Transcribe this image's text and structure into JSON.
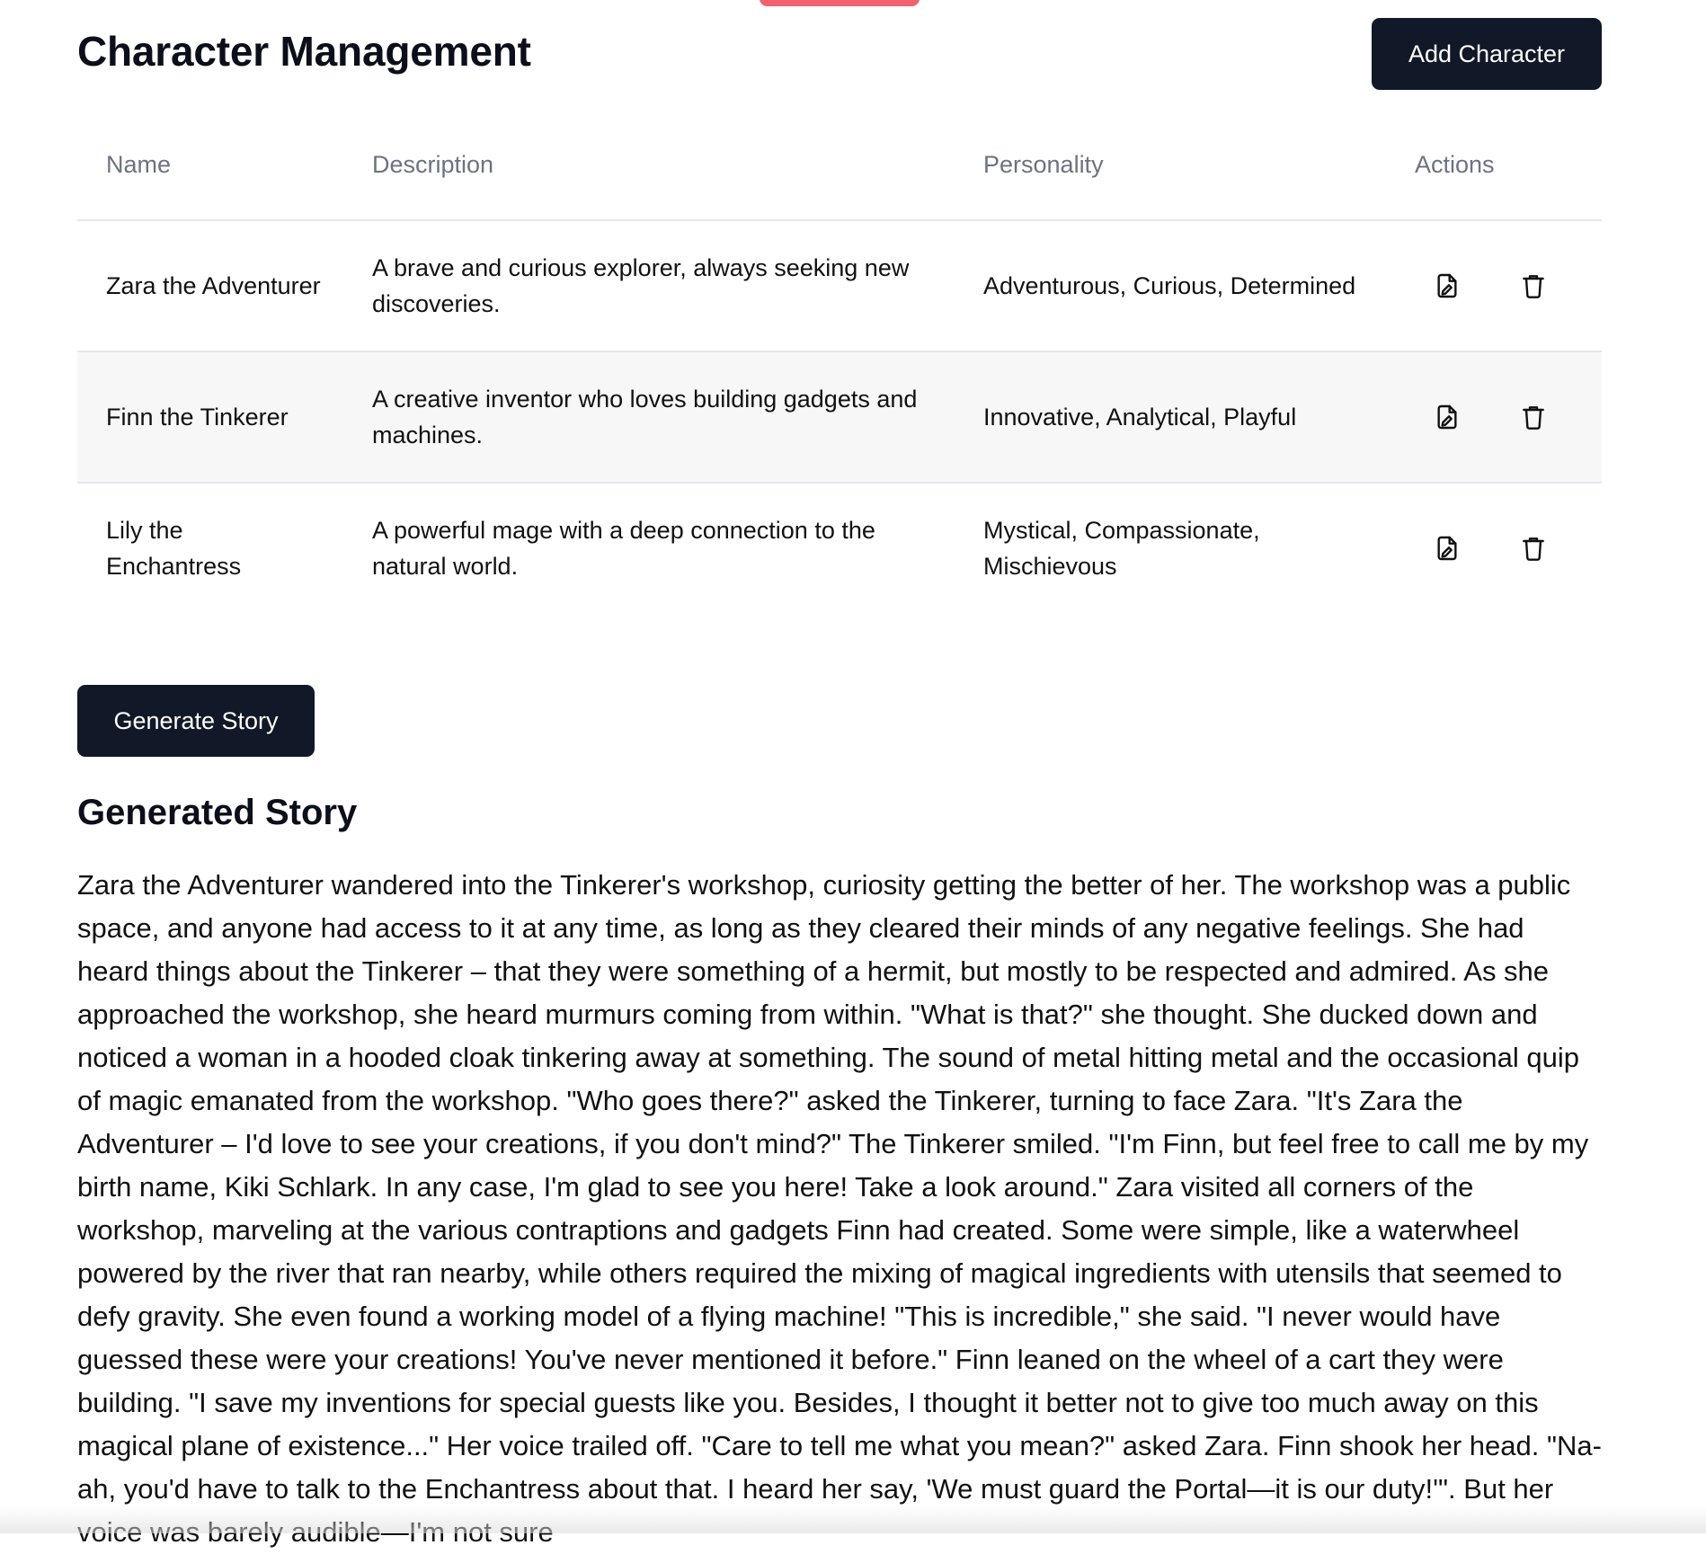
{
  "header": {
    "title": "Character Management",
    "add_button_label": "Add Character"
  },
  "table": {
    "columns": [
      "Name",
      "Description",
      "Personality",
      "Actions"
    ],
    "rows": [
      {
        "name": "Zara the Adventurer",
        "description": "A brave and curious explorer, always seeking new discoveries.",
        "personality": "Adventurous, Curious, Determined"
      },
      {
        "name": "Finn the Tinkerer",
        "description": "A creative inventor who loves building gadgets and machines.",
        "personality": "Innovative, Analytical, Playful"
      },
      {
        "name": "Lily the Enchantress",
        "description": "A powerful mage with a deep connection to the natural world.",
        "personality": "Mystical, Compassionate, Mischievous"
      }
    ],
    "action_icons": [
      "edit-icon",
      "trash-icon"
    ]
  },
  "generate_button_label": "Generate Story",
  "story": {
    "title": "Generated Story",
    "text": "Zara the Adventurer wandered into the Tinkerer's workshop, curiosity getting the better of her. The workshop was a public space, and anyone had access to it at any time, as long as they cleared their minds of any negative feelings. She had heard things about the Tinkerer – that they were something of a hermit, but mostly to be respected and admired. As she approached the workshop, she heard murmurs coming from within. \"What is that?\" she thought. She ducked down and noticed a woman in a hooded cloak tinkering away at something. The sound of metal hitting metal and the occasional quip of magic emanated from the workshop. \"Who goes there?\" asked the Tinkerer, turning to face Zara. \"It's Zara the Adventurer – I'd love to see your creations, if you don't mind?\" The Tinkerer smiled. \"I'm Finn, but feel free to call me by my birth name, Kiki Schlark. In any case, I'm glad to see you here! Take a look around.\" Zara visited all corners of the workshop, marveling at the various contraptions and gadgets Finn had created. Some were simple, like a waterwheel powered by the river that ran nearby, while others required the mixing of magical ingredients with utensils that seemed to defy gravity. She even found a working model of a flying machine! \"This is incredible,\" she said. \"I never would have guessed these were your creations! You've never mentioned it before.\" Finn leaned on the wheel of a cart they were building. \"I save my inventions for special guests like you. Besides, I thought it better not to give too much away on this magical plane of existence...\" Her voice trailed off. \"Care to tell me what you mean?\" asked Zara. Finn shook her head. \"Na-ah, you'd have to talk to the Enchantress about that. I heard her say, 'We must guard the Portal—it is our duty!'\". But her voice was barely audible—I'm not sure"
  },
  "colors": {
    "primary_button": "#111827",
    "header_text": "#6b7280",
    "row_alt": "#f7f7f8",
    "top_tab": "#f0636f"
  }
}
